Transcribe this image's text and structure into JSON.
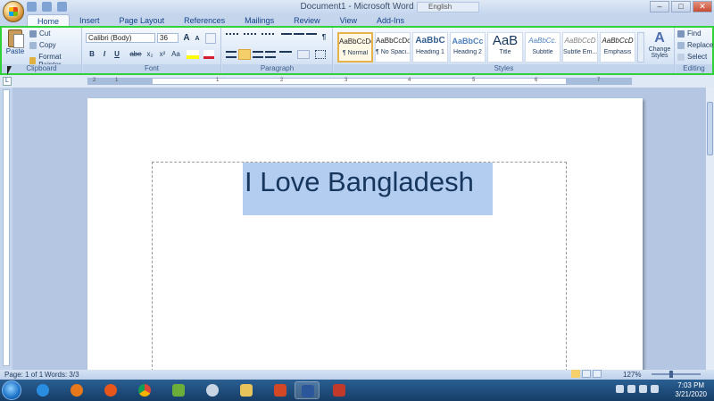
{
  "window": {
    "title": "Document1 - Microsoft Word",
    "language_box": "English",
    "controls": [
      "–",
      "□",
      "✕"
    ]
  },
  "tabs": [
    "Home",
    "Insert",
    "Page Layout",
    "References",
    "Mailings",
    "Review",
    "View",
    "Add-Ins"
  ],
  "active_tab": "Home",
  "ribbon": {
    "clipboard": {
      "label": "Clipboard",
      "paste": "Paste",
      "cut": "Cut",
      "copy": "Copy",
      "format_painter": "Format Painter"
    },
    "font": {
      "label": "Font",
      "font_name": "Calibri (Body)",
      "font_size": "36",
      "bold": "B",
      "italic": "I",
      "underline": "U",
      "strike": "abe",
      "subscript": "x₂",
      "superscript": "x²",
      "change_case": "Aa",
      "grow": "A",
      "shrink": "A"
    },
    "paragraph": {
      "label": "Paragraph"
    },
    "styles": {
      "label": "Styles",
      "items": [
        {
          "sample": "AaBbCcDc",
          "name": "¶ Normal"
        },
        {
          "sample": "AaBbCcDc",
          "name": "¶ No Spaci..."
        },
        {
          "sample": "AaBbC",
          "name": "Heading 1"
        },
        {
          "sample": "AaBbCc",
          "name": "Heading 2"
        },
        {
          "sample": "AaB",
          "name": "Title"
        },
        {
          "sample": "AaBbCc.",
          "name": "Subtitle"
        },
        {
          "sample": "AaBbCcD",
          "name": "Subtle Em..."
        },
        {
          "sample": "AaBbCcD",
          "name": "Emphasis"
        }
      ],
      "change_styles": "Change Styles"
    },
    "editing": {
      "label": "Editing",
      "find": "Find",
      "replace": "Replace",
      "select": "Select"
    }
  },
  "ruler_numbers": [
    "1",
    "2",
    "1",
    "2",
    "3",
    "4",
    "5",
    "6",
    "7"
  ],
  "document": {
    "text": "I Love Bangladesh"
  },
  "status": {
    "page": "Page: 1 of 1",
    "words": "Words: 3/3",
    "zoom": "127%"
  },
  "clock": {
    "time": "7:03 PM",
    "date": "3/21/2020"
  },
  "colors": {
    "selection": "#b3cdf0",
    "doc_text": "#17365d",
    "ribbon_highlight": "#31d13a"
  }
}
